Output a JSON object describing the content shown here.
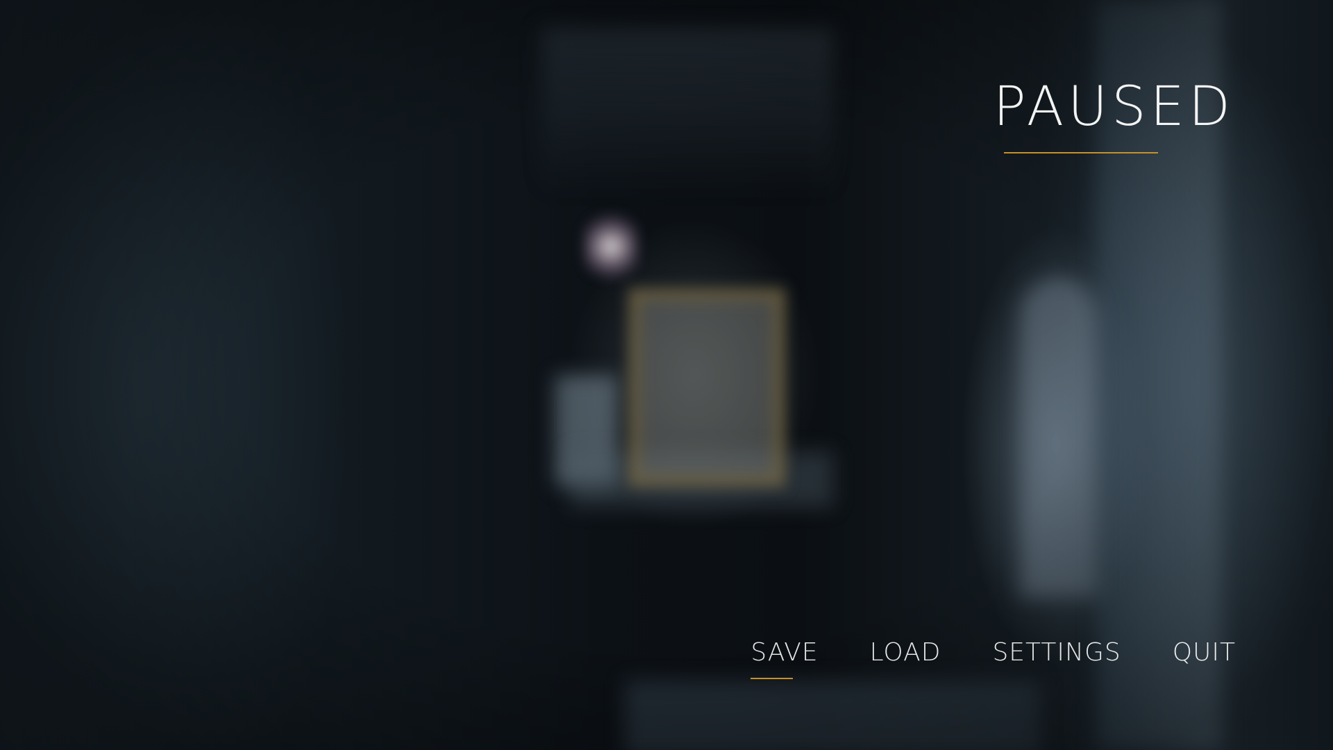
{
  "pause_screen": {
    "title": "PAUSED",
    "accent_color": "#c8902a",
    "menu": [
      {
        "label": "SAVE",
        "selected": true
      },
      {
        "label": "LOAD",
        "selected": false
      },
      {
        "label": "SETTINGS",
        "selected": false
      },
      {
        "label": "QUIT",
        "selected": false
      }
    ]
  }
}
